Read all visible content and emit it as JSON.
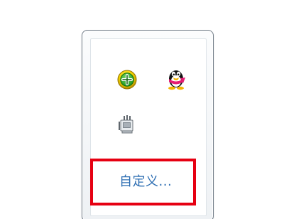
{
  "tray": {
    "icons": [
      {
        "name": "360-safe-guard-icon"
      },
      {
        "name": "qq-penguin-icon"
      },
      {
        "name": "network-plug-icon"
      }
    ],
    "customize_label": "自定义..."
  },
  "colors": {
    "highlight": "#e60012",
    "link": "#2f6fb3",
    "window_border": "#6f7b86"
  }
}
